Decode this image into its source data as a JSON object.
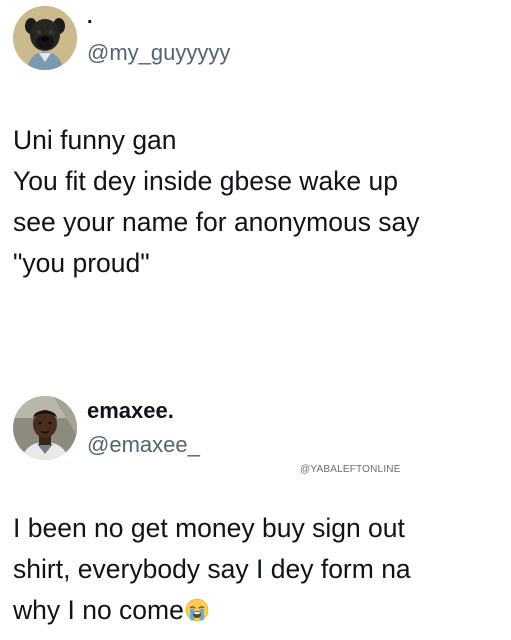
{
  "tweets": [
    {
      "display_name": ".",
      "handle": "@my_guyyyyy",
      "avatar_icon": "pug-dog-avatar",
      "text_lines": [
        "Uni funny gan",
        "You fit dey inside gbese wake up",
        "see your name for anonymous say",
        "\"you proud\""
      ]
    },
    {
      "display_name": "emaxee.",
      "handle": "@emaxee_",
      "avatar_icon": "man-selfie-avatar",
      "watermark": "@YABALEFTONLINE",
      "text_lines": [
        "I been no get money buy sign out",
        "shirt, everybody say I dey form na",
        "why I no come"
      ],
      "emoji_icon": "loudly-crying-face-icon"
    }
  ],
  "colors": {
    "text": "#0f1419",
    "handle": "#536471",
    "watermark": "#6b6b6b",
    "background": "#ffffff"
  }
}
